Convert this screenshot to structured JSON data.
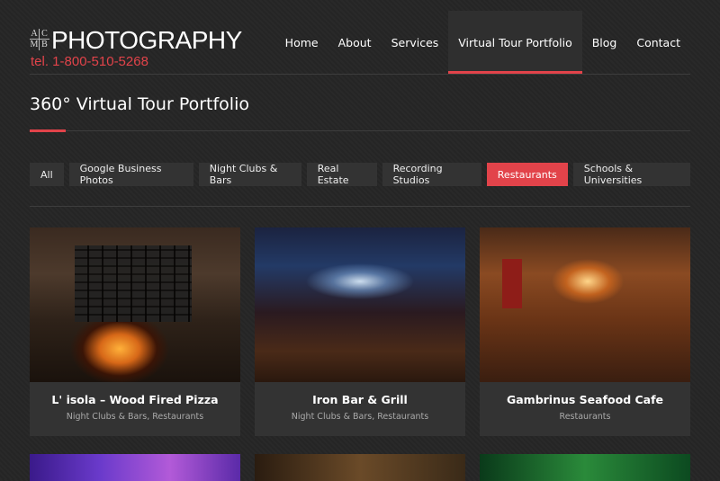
{
  "logo": {
    "mark": [
      "A",
      "C",
      "M",
      "B"
    ],
    "text": "PHOTOGRAPHY",
    "phone": "tel. 1-800-510-5268"
  },
  "nav": {
    "items": [
      {
        "label": "Home"
      },
      {
        "label": "About"
      },
      {
        "label": "Services"
      },
      {
        "label": "Virtual Tour Portfolio",
        "active": true
      },
      {
        "label": "Blog"
      },
      {
        "label": "Contact"
      }
    ]
  },
  "page": {
    "title": "360° Virtual Tour Portfolio"
  },
  "filters": [
    {
      "label": "All"
    },
    {
      "label": "Google Business Photos"
    },
    {
      "label": "Night Clubs & Bars"
    },
    {
      "label": "Real Estate"
    },
    {
      "label": "Recording Studios"
    },
    {
      "label": "Restaurants",
      "active": true
    },
    {
      "label": "Schools & Universities"
    }
  ],
  "cards": [
    {
      "title": "L' isola – Wood Fired Pizza",
      "categories": "Night Clubs & Bars, Restaurants"
    },
    {
      "title": "Iron Bar & Grill",
      "categories": "Night Clubs & Bars, Restaurants"
    },
    {
      "title": "Gambrinus Seafood Cafe",
      "categories": "Restaurants"
    }
  ],
  "colors": {
    "accent": "#e2434a",
    "background": "#262626",
    "card": "#333333"
  }
}
